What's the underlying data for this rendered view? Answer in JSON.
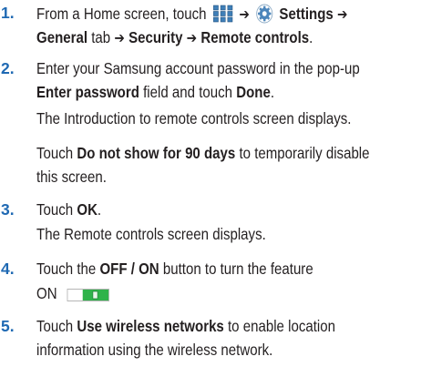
{
  "steps": [
    {
      "num": "1.",
      "line1": {
        "a": "From a Home screen, touch",
        "arrow1": "➔",
        "settings": "Settings",
        "arrow2": "➔"
      },
      "line2": {
        "general": "General",
        "tab": "tab",
        "arrow1": "➔",
        "security": "Security",
        "arrow2": "➔",
        "remote": "Remote controls",
        "end": "."
      }
    },
    {
      "num": "2.",
      "line1": {
        "a": "Enter your Samsung account password in the pop-up"
      },
      "line2": {
        "field": "Enter password",
        "b": "field and touch",
        "done": "Done",
        "end": "."
      },
      "line3": {
        "a": "The Introduction to remote controls screen displays."
      },
      "line4": {
        "a": "Touch",
        "b": "Do not show for 90 days",
        "c": "to temporarily disable"
      },
      "line5": {
        "a": "this screen."
      }
    },
    {
      "num": "3.",
      "line1": {
        "a": "Touch",
        "ok": "OK",
        "end": "."
      },
      "line2": {
        "a": "The Remote controls screen displays."
      }
    },
    {
      "num": "4.",
      "line1": {
        "a": "Touch the",
        "b": "OFF / ON",
        "c": "button to turn the feature"
      },
      "line2": {
        "a": "ON"
      }
    },
    {
      "num": "5.",
      "line1": {
        "a": "Touch",
        "b": "Use wireless networks",
        "c": "to enable location"
      },
      "line2": {
        "a": "information using the wireless network."
      }
    }
  ],
  "icons": {
    "apps": "apps-grid-icon",
    "settings": "settings-gear-icon",
    "toggle": "toggle-switch-icon"
  },
  "toggle_state": "on",
  "colors": {
    "step_number": "#1f69b3",
    "text": "#231f20",
    "toggle_on": "#2fb34a"
  }
}
